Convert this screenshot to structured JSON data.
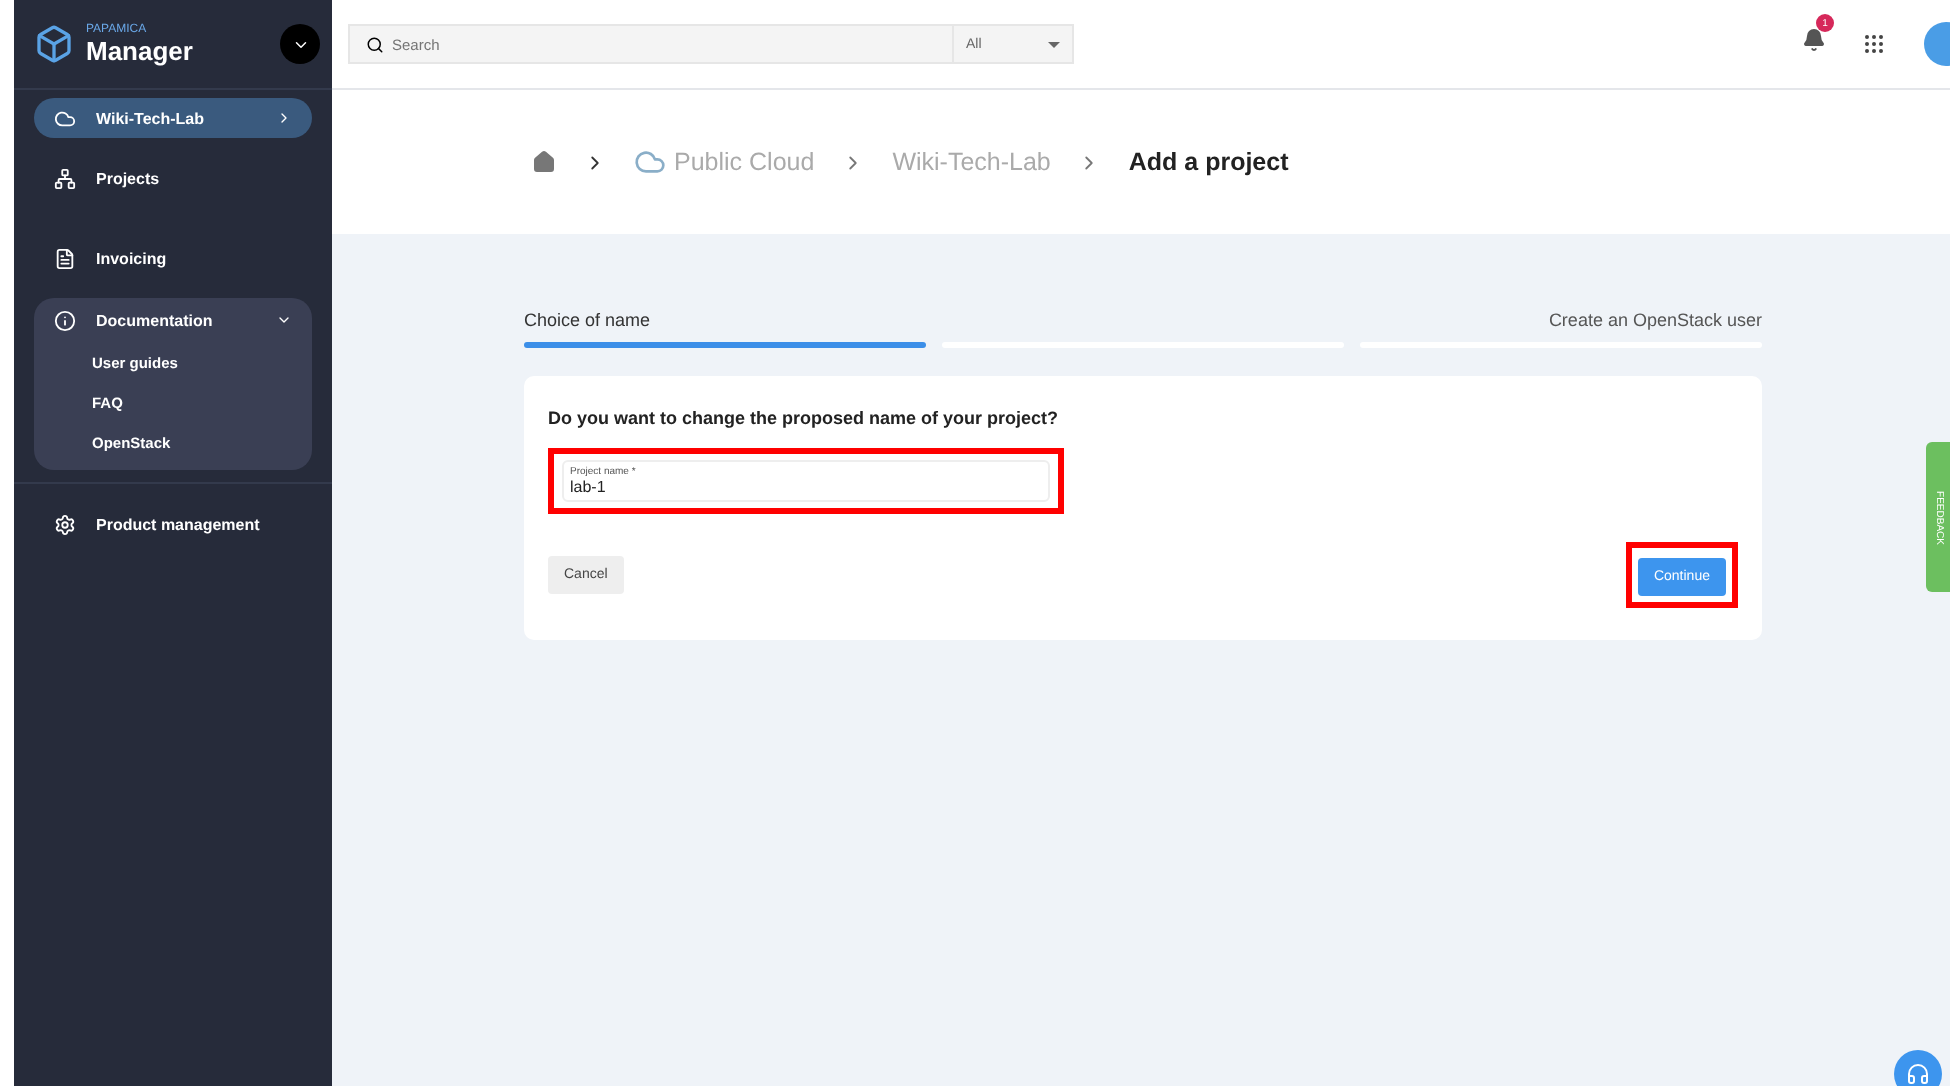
{
  "sidebar": {
    "brand": "PAPAMICA",
    "title": "Manager",
    "items": [
      {
        "kind": "project",
        "label": "Wiki-Tech-Lab",
        "selected": true
      },
      {
        "kind": "link",
        "label": "Projects",
        "selected": false
      },
      {
        "kind": "link",
        "label": "Invoicing",
        "selected": false
      },
      {
        "kind": "group",
        "label": "Documentation",
        "expanded": true,
        "children": [
          {
            "label": "User guides"
          },
          {
            "label": "FAQ"
          },
          {
            "label": "OpenStack"
          }
        ]
      },
      {
        "kind": "link",
        "label": "Product management",
        "selected": false
      }
    ]
  },
  "topbar": {
    "search": {
      "placeholder": "Search"
    },
    "filter": "All",
    "notifications": "1"
  },
  "breadcrumb": [
    {
      "label": "Public Cloud",
      "kind": "cloud",
      "current": false
    },
    {
      "label": "Wiki-Tech-Lab",
      "kind": "text",
      "current": false
    },
    {
      "label": "Add a project",
      "kind": "text",
      "current": true
    }
  ],
  "steps": [
    {
      "label": "Choice of name",
      "selected": true
    },
    {
      "selected": false
    },
    {
      "label": "Create an OpenStack user",
      "selected": false
    }
  ],
  "form": {
    "question": "Do you want to change the proposed name of your project?",
    "field": {
      "label": "Project name *",
      "value": "lab-1",
      "highlighted": true
    },
    "cancel": "Cancel",
    "continue": {
      "label": "Continue",
      "highlighted": true
    }
  },
  "feedback": "FEEDBACK"
}
